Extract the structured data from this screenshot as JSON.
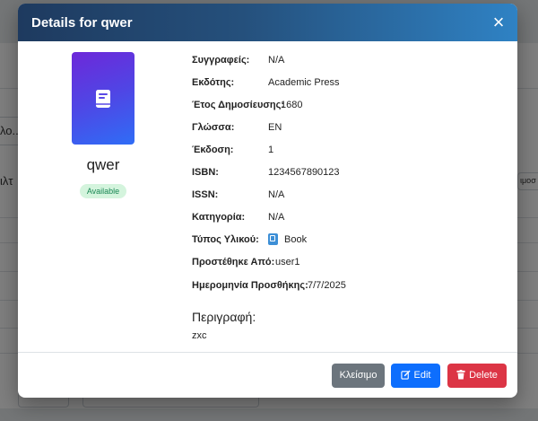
{
  "modal": {
    "title": "Details for qwer",
    "close_icon": "×"
  },
  "item": {
    "name": "qwer",
    "status": "Available"
  },
  "details": [
    {
      "label": "Συγγραφείς:",
      "value": "N/A"
    },
    {
      "label": "Εκδότης:",
      "value": "Academic Press"
    },
    {
      "label": "Έτος Δημοσίευσης:",
      "value": "1680"
    },
    {
      "label": "Γλώσσα:",
      "value": "EN"
    },
    {
      "label": "Έκδοση:",
      "value": "1"
    },
    {
      "label": "ISBN:",
      "value": "1234567890123"
    },
    {
      "label": "ISSN:",
      "value": "N/A"
    },
    {
      "label": "Κατηγορία:",
      "value": "N/A"
    },
    {
      "label": "Τύπος Υλικού:",
      "value": "Book",
      "icon": "book-icon"
    },
    {
      "label": "Προστέθηκε Από:",
      "value": "user1"
    },
    {
      "label": "Ημερομηνία Προσθήκης:",
      "value": "7/7/2025"
    }
  ],
  "description": {
    "heading": "Περιγραφή:",
    "text": "zxc"
  },
  "footer": {
    "close_label": "Κλείσιμο",
    "edit_label": "Edit",
    "delete_label": "Delete"
  },
  "background": {
    "text_1": "λο...",
    "text_2": "ιλτ",
    "text_3": "ιμοσ"
  },
  "colors": {
    "header_start": "#1e3a5f",
    "header_end": "#2f82c4",
    "cover_start": "#6d28d9",
    "cover_end": "#2f6df6",
    "status_bg": "#d4f4dd",
    "status_text": "#198754",
    "close_button": "#6c757d",
    "edit_button": "#0d6efd",
    "delete_button": "#dc3545"
  }
}
